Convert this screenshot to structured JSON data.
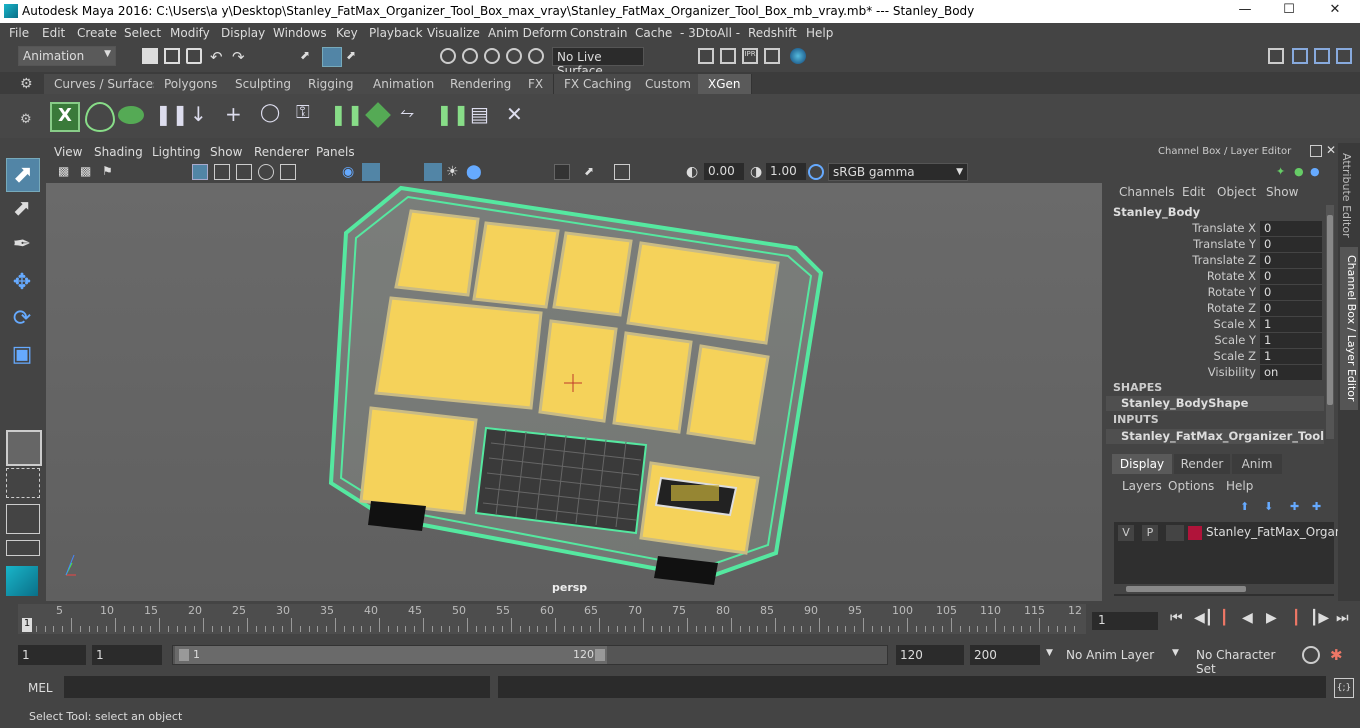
{
  "window": {
    "title": "Autodesk Maya 2016: C:\\Users\\a y\\Desktop\\Stanley_FatMax_Organizer_Tool_Box_max_vray\\Stanley_FatMax_Organizer_Tool_Box_mb_vray.mb*   ---   Stanley_Body",
    "minimize": "—",
    "maximize": "☐",
    "close": "✕"
  },
  "menubar": [
    "File",
    "Edit",
    "Create",
    "Select",
    "Modify",
    "Display",
    "Windows",
    "Key",
    "Playback",
    "Visualize",
    "Anim Deform",
    "Constrain",
    "Cache",
    "- 3DtoAll -",
    "Redshift",
    "Help"
  ],
  "status": {
    "mode": "Animation",
    "live_surface": "No Live Surface"
  },
  "shelf_tabs": [
    "Curves / Surfaces",
    "Polygons",
    "Sculpting",
    "Rigging",
    "Animation",
    "Rendering",
    "FX",
    "FX Caching",
    "Custom",
    "XGen"
  ],
  "active_shelf": "XGen",
  "viewport": {
    "menu": [
      "View",
      "Shading",
      "Lighting",
      "Show",
      "Renderer",
      "Panels"
    ],
    "exposure": "0.00",
    "gamma": "1.00",
    "colorspace": "sRGB gamma",
    "camera": "persp"
  },
  "channel_box": {
    "panel_title": "Channel Box / Layer Editor",
    "menu": [
      "Channels",
      "Edit",
      "Object",
      "Show"
    ],
    "object": "Stanley_Body",
    "attributes": [
      {
        "label": "Translate X",
        "value": "0"
      },
      {
        "label": "Translate Y",
        "value": "0"
      },
      {
        "label": "Translate Z",
        "value": "0"
      },
      {
        "label": "Rotate X",
        "value": "0"
      },
      {
        "label": "Rotate Y",
        "value": "0"
      },
      {
        "label": "Rotate Z",
        "value": "0"
      },
      {
        "label": "Scale X",
        "value": "1"
      },
      {
        "label": "Scale Y",
        "value": "1"
      },
      {
        "label": "Scale Z",
        "value": "1"
      },
      {
        "label": "Visibility",
        "value": "on"
      }
    ],
    "shapes_header": "SHAPES",
    "shape_name": "Stanley_BodyShape",
    "inputs_header": "INPUTS",
    "input_name": "Stanley_FatMax_Organizer_Tool_Box"
  },
  "layer_editor": {
    "tabs": [
      "Display",
      "Render",
      "Anim"
    ],
    "active_tab": "Display",
    "menu": [
      "Layers",
      "Options",
      "Help"
    ],
    "layer": {
      "v": "V",
      "p": "P",
      "name": "Stanley_FatMax_Organiz",
      "color": "#b0143a"
    }
  },
  "side_tabs": [
    "Attribute Editor",
    "Channel Box / Layer Editor"
  ],
  "timeline": {
    "labels": [
      "5",
      "10",
      "15",
      "20",
      "25",
      "30",
      "35",
      "40",
      "45",
      "50",
      "55",
      "60",
      "65",
      "70",
      "75",
      "80",
      "85",
      "90",
      "95",
      "100",
      "105",
      "110",
      "115",
      "12"
    ],
    "start_marker": "1",
    "current_frame": "1"
  },
  "range": {
    "start": "1",
    "playback_start": "1",
    "slider_start": "1",
    "slider_end": "120",
    "playback_end": "120",
    "end": "200",
    "anim_layer": "No Anim Layer",
    "character_set": "No Character Set"
  },
  "command": {
    "lang": "MEL"
  },
  "help_line": "Select Tool: select an object"
}
